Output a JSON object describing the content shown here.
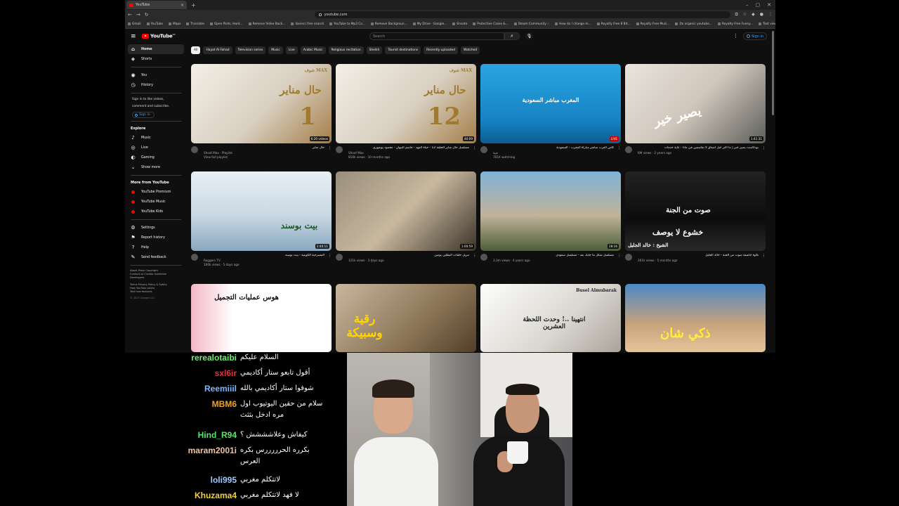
{
  "browser": {
    "tab_title": "YouTube",
    "url": "youtube.com",
    "bookmarks": [
      "Gmail",
      "YouTube",
      "Maps",
      "Translate",
      "Open Ports, Hard...",
      "Remove Video Back...",
      "davinci free search",
      "YouTube to Mp3 Co...",
      "Remove Backgroun...",
      "My Drive - Google...",
      "Envato",
      "Protective Cases &...",
      "Steam Community ::",
      "How do I change m...",
      "Royalty Free 8 Bit...",
      "Royalty Free Musi...",
      "Do organic youtube...",
      "Royalty Free Funny...",
      "Text view React com..."
    ]
  },
  "youtube": {
    "search_placeholder": "Search",
    "sign_in": "Sign in",
    "sidebar": {
      "items": [
        {
          "label": "Home",
          "icon": "home-icon"
        },
        {
          "label": "Shorts",
          "icon": "shorts-icon"
        },
        {
          "label": "You",
          "icon": "you-icon"
        },
        {
          "label": "History",
          "icon": "history-icon"
        }
      ],
      "signin_prompt": [
        "Sign in to like videos,",
        "comment and subscribe."
      ],
      "signin_label": "Sign in",
      "explore_title": "Explore",
      "explore": [
        {
          "label": "Music",
          "icon": "music-icon"
        },
        {
          "label": "Live",
          "icon": "live-icon"
        },
        {
          "label": "Gaming",
          "icon": "gaming-icon"
        },
        {
          "label": "Show more",
          "icon": "chevron-down-icon"
        }
      ],
      "more_title": "More from YouTube",
      "more": [
        {
          "label": "YouTube Premium"
        },
        {
          "label": "YouTube Music"
        },
        {
          "label": "YouTube Kids"
        }
      ],
      "settings": [
        {
          "label": "Settings",
          "icon": "gear-icon"
        },
        {
          "label": "Report history",
          "icon": "flag-icon"
        },
        {
          "label": "Help",
          "icon": "help-icon"
        },
        {
          "label": "Send feedback",
          "icon": "feedback-icon"
        }
      ],
      "footer1": "About  Press  Copyright\nContact us  Creator  Advertise\nDevelopers",
      "footer2": "Terms  Privacy  Policy & Safety\nHow YouTube works\nTest new features",
      "copyright": "© 2025 Google LLC"
    },
    "chips": [
      "All",
      "Hayat Al Fahad",
      "Television series",
      "Music",
      "Live",
      "Arabic Music",
      "Religious recitation",
      "Sheikh",
      "Tourist destinations",
      "Recently uploaded",
      "Watched"
    ],
    "videos": [
      {
        "overlay": "حال مناير",
        "num": "1",
        "badge": "شوف MAX",
        "duration": "6:20 videos",
        "title": "حال مناير",
        "channel": "Shoof Max · Playlist",
        "stats": "View full playlist",
        "extra": ""
      },
      {
        "overlay": "حال مناير",
        "num": "12",
        "badge": "شوف MAX",
        "duration": "40:09",
        "title": "مسلسل حال مناير الحلقة 12 - حياة الفهد - جاسم النبهان - محمود بوشهري",
        "channel": "Shoof Max",
        "stats": "810k views · 10 months ago",
        "extra": ""
      },
      {
        "overlay": "المغرب مباشر السعودية",
        "num": "",
        "badge": "",
        "duration": "LIVE",
        "title": "كأس العرب مباشر مباراة المغرب - السعودية",
        "channel": "فيفا",
        "stats": "761K watching",
        "extra": ""
      },
      {
        "overlay": "يصير خير",
        "num": "",
        "badge": "",
        "duration": "1:41:31",
        "title": "بودكاست يصير خير | ما أكبر أمل أشتاق لا تقاسمين في ماذا - غاية خدمات",
        "channel": "",
        "stats": "6M views · 2 years ago",
        "extra": ""
      },
      {
        "overlay": "بيت بوسند",
        "num": "",
        "badge": "",
        "duration": "2:40:11",
        "title": "المسرحية الكويتية - بيت بوسند",
        "channel": "Roggers TV",
        "stats": "100k views · 5 days ago",
        "extra": ""
      },
      {
        "overlay": "",
        "num": "",
        "badge": "",
        "duration": "1:00:59",
        "title": "تنزيل حلقات البطلين يومين",
        "channel": "",
        "stats": "121k views · 3 days ago",
        "extra": ""
      },
      {
        "overlay": "",
        "num": "",
        "badge": "",
        "duration": "28:16",
        "title": "مسلسل شكل ما جابك بعد - مسلسل سعودي",
        "channel": "",
        "stats": "3.3m views · 4 years ago",
        "extra": ""
      },
      {
        "overlay": "خشوع لا يوصف",
        "num": "",
        "badge": "صوت من الجنة",
        "duration": "",
        "title": "تلاوة خاشعة صوت من الجنة - خالد الجليل",
        "channel": "",
        "stats": "261k views · 5 months ago",
        "extra": "الشيخ : خالد الجليل"
      },
      {
        "overlay": "هوس عمليات التجميل",
        "num": "",
        "badge": "",
        "duration": "",
        "title": "",
        "channel": "",
        "stats": "",
        "extra": ""
      },
      {
        "overlay": "رقية وسبيكة",
        "num": "",
        "badge": "",
        "duration": "",
        "title": "",
        "channel": "",
        "stats": "",
        "extra": ""
      },
      {
        "overlay": "انتهينا ..! وحدت اللحظة العشرين",
        "num": "",
        "badge": "Busel Almubarak",
        "duration": "",
        "title": "",
        "channel": "",
        "stats": "",
        "extra": ""
      },
      {
        "overlay": "ذكي شان",
        "num": "",
        "badge": "",
        "duration": "",
        "title": "",
        "channel": "",
        "stats": "",
        "extra": ""
      }
    ]
  },
  "chat": [
    {
      "user": "rerealotaibi",
      "color": "#6ff06f",
      "text": "السلام عليكم",
      "text2": ""
    },
    {
      "user": "sxl6ir",
      "color": "#e0343c",
      "text": "أقول تابعو ستار أكاديمي",
      "text2": ""
    },
    {
      "user": "Reemiiil",
      "color": "#7ab8ff",
      "text": "شوفوا ستار أكاديمي بالله",
      "text2": ""
    },
    {
      "user": "MBM6",
      "color": "#f0a428",
      "text": "سلام من حقين اليوتيوب اول",
      "text2": "مره ادخل بثثث"
    },
    {
      "user": "Hind_R94",
      "color": "#5fe36a",
      "text": "كيفاش وعلاشششش ؟",
      "text2": ""
    },
    {
      "user": "maram2001i",
      "color": "#f0c2a0",
      "text": "بكرره الحرررررس بكره",
      "text2": "العرس"
    },
    {
      "user": "loli995",
      "color": "#9bc8ff",
      "text": "لاتتكلم مغربي",
      "text2": ""
    },
    {
      "user": "Khuzama4",
      "color": "#f1d14a",
      "text": "لا فهد لاتتكلم مغربي",
      "text2": ""
    }
  ]
}
